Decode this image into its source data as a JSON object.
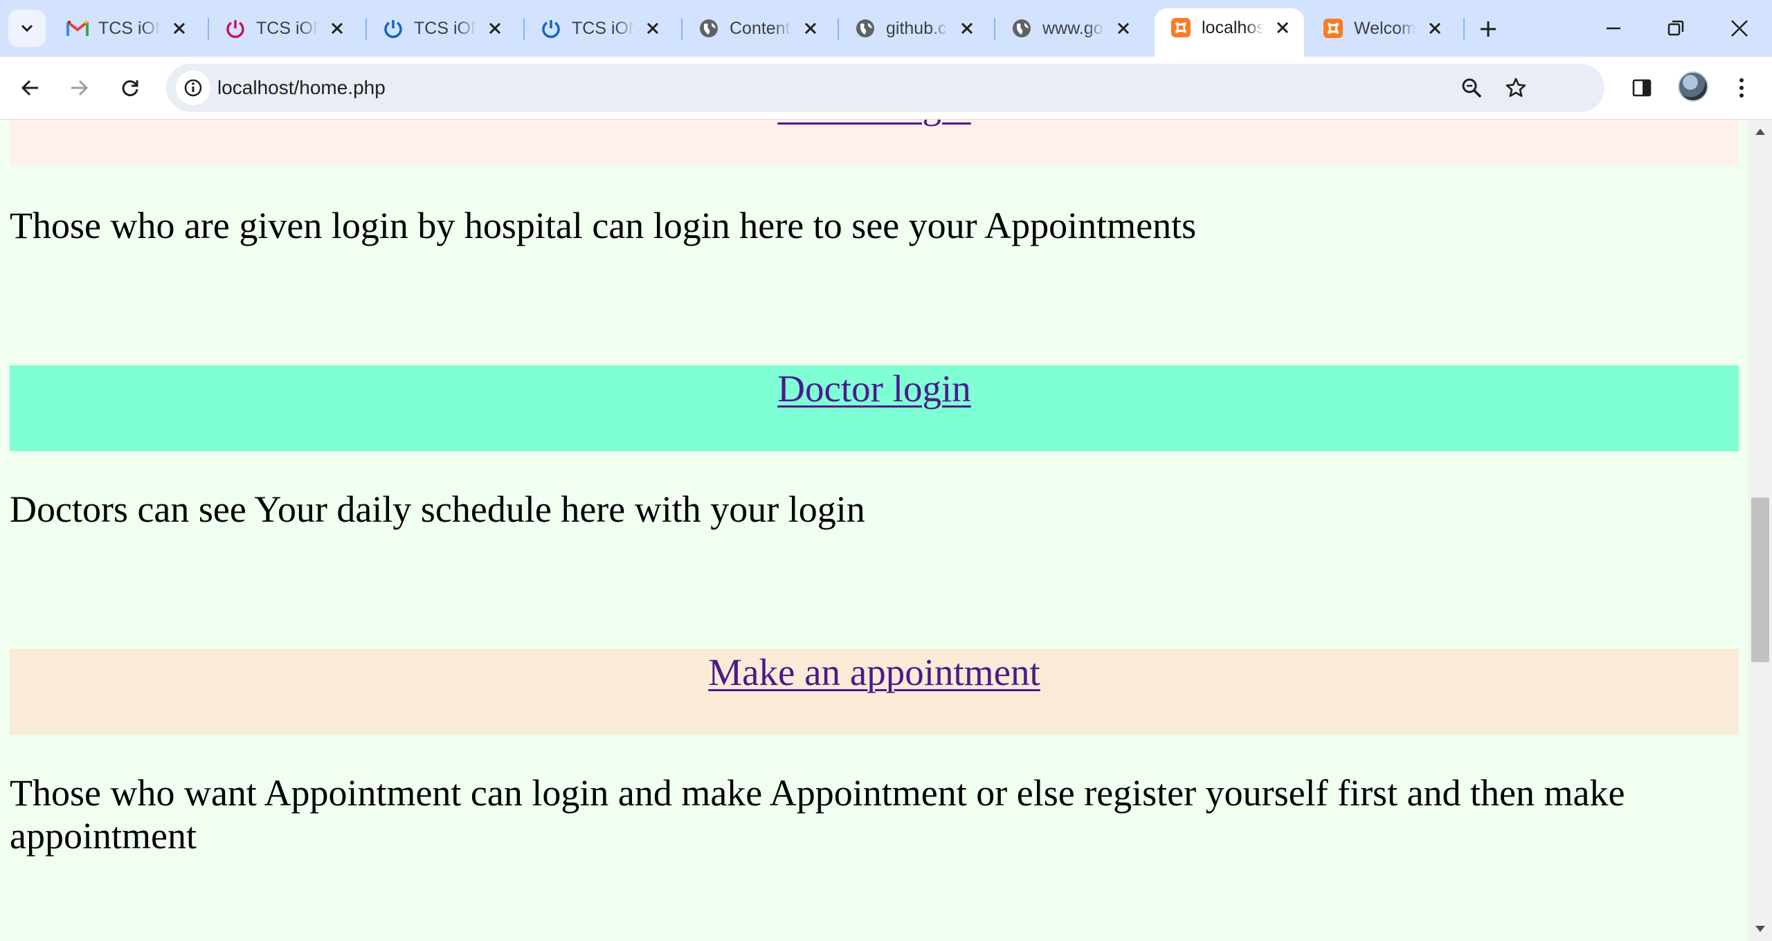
{
  "browser": {
    "tabs": [
      {
        "title": "TCS iON",
        "icon": "gmail-icon"
      },
      {
        "title": "TCS iON",
        "icon": "tcs-ion-power-icon"
      },
      {
        "title": "TCS iON",
        "icon": "tcs-ion-power-icon"
      },
      {
        "title": "TCS iON",
        "icon": "tcs-ion-power-icon"
      },
      {
        "title": "Content",
        "icon": "globe-icon"
      },
      {
        "title": "github.c",
        "icon": "globe-icon"
      },
      {
        "title": "www.go",
        "icon": "globe-icon"
      },
      {
        "title": "localhos",
        "icon": "xampp-icon",
        "active": true
      },
      {
        "title": "Welcom",
        "icon": "xampp-icon"
      }
    ],
    "address": {
      "url": "localhost/home.php"
    }
  },
  "page": {
    "sections": [
      {
        "link_label": "Patient login",
        "band_color": "#fff0ee"
      },
      {
        "description": "Those who are given login by hospital can login here to see your Appointments"
      },
      {
        "link_label": "Doctor login",
        "band_color": "#7fffd4",
        "description": "Doctors can see Your daily schedule here with your login"
      },
      {
        "link_label": "Make an appointment",
        "band_color": "#faebd7",
        "description": "Those who want Appointment can login and make Appointment or else register yourself first and then make appointment"
      }
    ]
  },
  "colors": {
    "page_background": "#f0fff0",
    "link": "#4b1a8c",
    "tabstrip": "#d3e3fd"
  }
}
